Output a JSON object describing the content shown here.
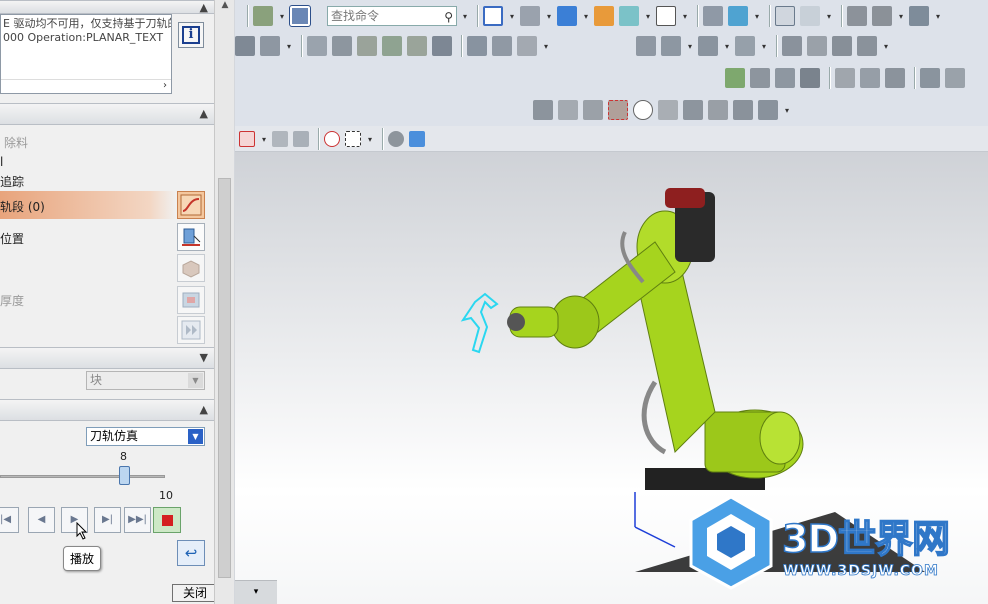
{
  "panel": {
    "messages": [
      "E 驱动均不可用，仅支持基于刀轨的",
      "000 Operation:PLANAR_TEXT"
    ],
    "rows": {
      "remove_material": "除料",
      "r1": "l",
      "trace": "追踪",
      "path_segment": "轨段 (0)",
      "position": "位置",
      "thickness": "厚度"
    },
    "block_select": "块",
    "sim_mode": "刀轨仿真",
    "speed_label": "8",
    "speed_max": "10",
    "speed_value": 0.72,
    "playback_buttons": [
      "|◀",
      "◀",
      "▶",
      "▶|",
      "▶▶|"
    ],
    "tooltip": "播放",
    "close_label": "关闭"
  },
  "toolbar": {
    "search_placeholder": "查找命令",
    "search_icon": "magnifier-icon",
    "info_icon": "info-icon"
  },
  "viewport": {
    "watermark_title": "3D世界网",
    "watermark_url": "WWW.3DSJW.COM",
    "robot_color": "#a6d41e",
    "accent_color": "#2f77c8"
  }
}
